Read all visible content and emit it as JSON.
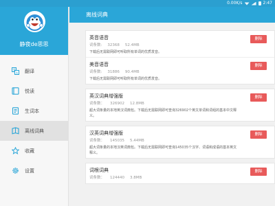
{
  "colors": {
    "accent": "#2aa6d8",
    "delete": "#e85a5a"
  },
  "statusbar": {
    "network": "0.00K/s",
    "time": "2:47"
  },
  "profile": {
    "name": "静夜de思思"
  },
  "nav": [
    {
      "label": "翻译",
      "icon": "translate-icon"
    },
    {
      "label": "悦读",
      "icon": "book-icon"
    },
    {
      "label": "生词本",
      "icon": "wordbook-icon"
    },
    {
      "label": "离线词典",
      "icon": "offline-dict-icon"
    },
    {
      "label": "收藏",
      "icon": "star-icon"
    },
    {
      "label": "设置",
      "icon": "gear-icon"
    }
  ],
  "header": {
    "title": "离线词典"
  },
  "delete_label": "删除",
  "cards": [
    [
      {
        "title": "英音语音",
        "count": "32368",
        "size": "52.4MB",
        "desc": "下载后无需联网即可听取所有单词的优质发音。"
      },
      {
        "title": "美音语音",
        "count": "31886",
        "size": "90.4MB",
        "desc": "下载后无需联网即可听取所有单词的优质发音。"
      }
    ],
    [
      {
        "title": "英汉词典增强版",
        "count": "326902",
        "size": "12.8MB",
        "desc": "超大词条量的本地英汉词典包。下载后无需联网即可查询326902个英文单词和词组的基本中文释义。"
      }
    ],
    [
      {
        "title": "汉英词典增强版",
        "count": "145035",
        "size": "5.44MB",
        "desc": "超大词条量的本地汉英词典包。下载后无需联网即可查询145035个汉字、词语和成语的基本英文释义。"
      }
    ],
    [
      {
        "title": "词根词典",
        "count": "124440",
        "size": "3.8MB",
        "desc": ""
      }
    ]
  ],
  "count_prefix_a": "词条数:",
  "count_prefix_b": "词条数："
}
